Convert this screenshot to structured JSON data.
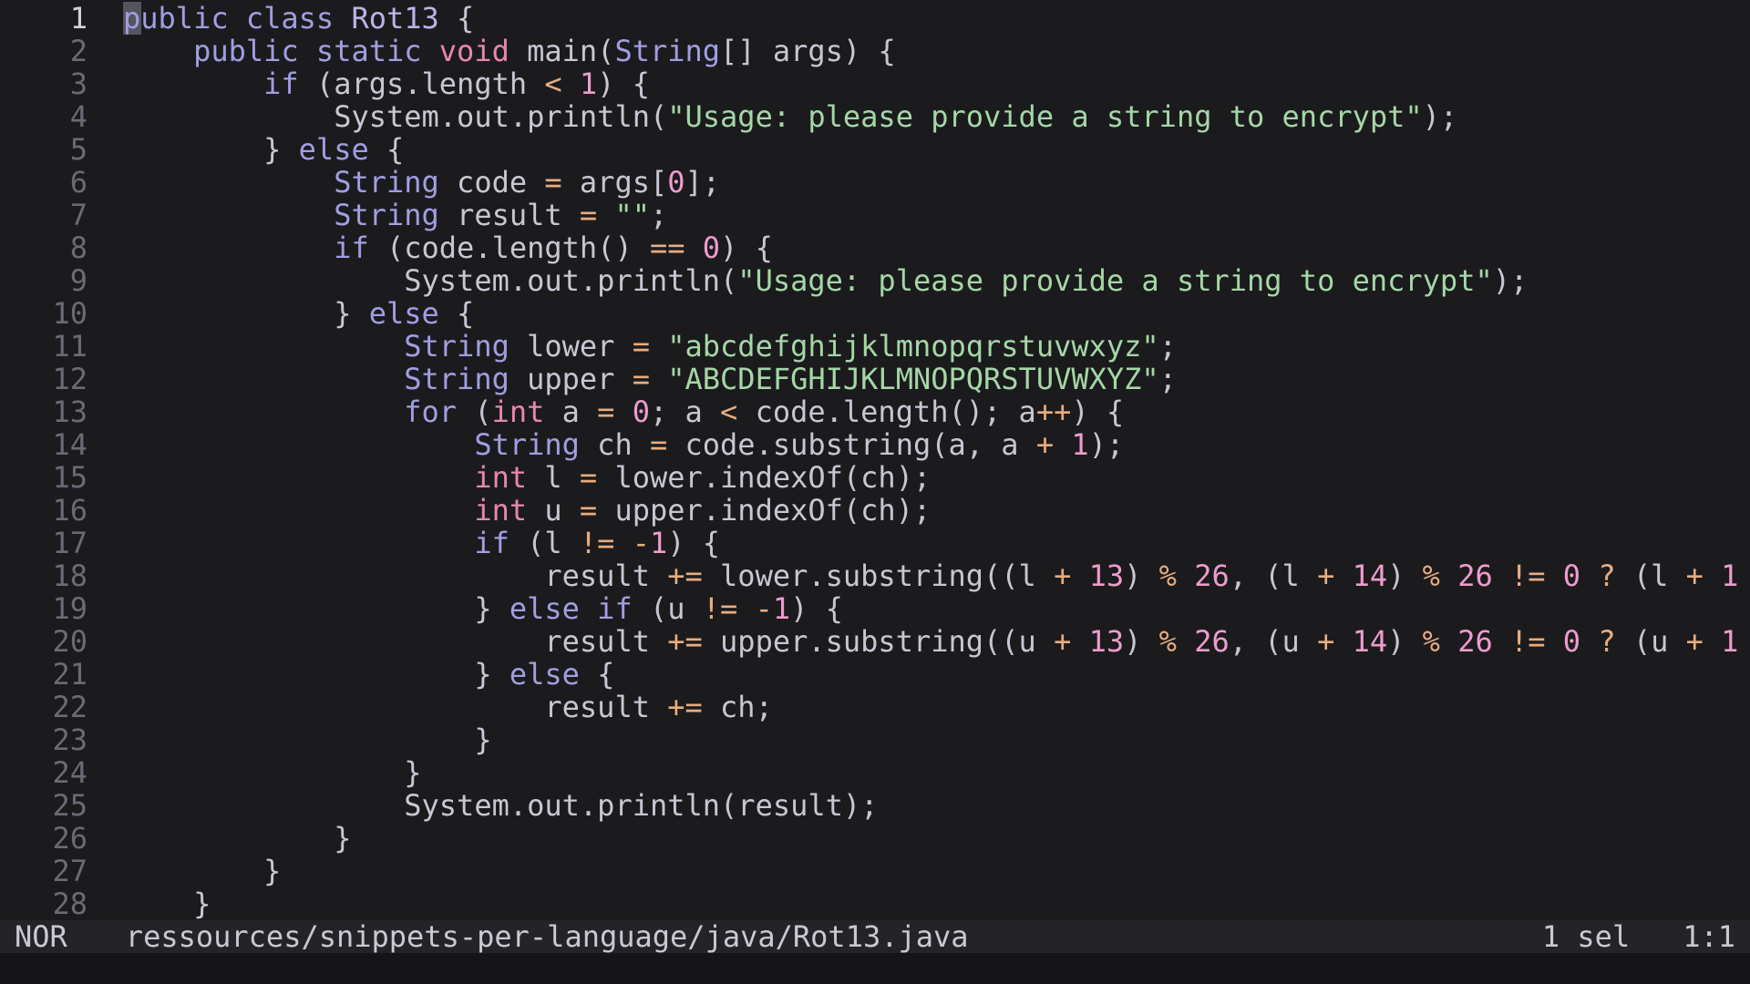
{
  "palette": {
    "bg": "#1b1b1d",
    "cmdBg": "#151517",
    "statusBg": "#242428",
    "statusFg": "#cac8d2",
    "gutter": "#6c6a75",
    "gutterCur": "#d4d1dc",
    "cursor": "#55555e",
    "tx": "#c8c6d2",
    "kw": "#a19ee3",
    "ty": "#bcb3e8",
    "pr": "#e787ad",
    "nu": "#ee9ccd",
    "op": "#e8ad80",
    "st": "#a5d7a7"
  },
  "editor": {
    "cursor": {
      "line": 1,
      "col": 0
    },
    "lines": [
      {
        "num": "1",
        "current": true,
        "tokens": [
          [
            "kw",
            "public"
          ],
          [
            "tx",
            " "
          ],
          [
            "kw",
            "class"
          ],
          [
            "tx",
            " "
          ],
          [
            "ty",
            "Rot13"
          ],
          [
            "tx",
            " {"
          ]
        ]
      },
      {
        "num": "2",
        "current": false,
        "tokens": [
          [
            "tx",
            "    "
          ],
          [
            "kw",
            "public"
          ],
          [
            "tx",
            " "
          ],
          [
            "kw",
            "static"
          ],
          [
            "tx",
            " "
          ],
          [
            "pr",
            "void"
          ],
          [
            "tx",
            " main("
          ],
          [
            "kw",
            "String"
          ],
          [
            "tx",
            "[] args) {"
          ]
        ]
      },
      {
        "num": "3",
        "current": false,
        "tokens": [
          [
            "tx",
            "        "
          ],
          [
            "kw",
            "if"
          ],
          [
            "tx",
            " (args.length "
          ],
          [
            "op",
            "<"
          ],
          [
            "tx",
            " "
          ],
          [
            "nu",
            "1"
          ],
          [
            "tx",
            ") {"
          ]
        ]
      },
      {
        "num": "4",
        "current": false,
        "tokens": [
          [
            "tx",
            "            System.out.println("
          ],
          [
            "st",
            "\"Usage: please provide a string to encrypt\""
          ],
          [
            "tx",
            ");"
          ]
        ]
      },
      {
        "num": "5",
        "current": false,
        "tokens": [
          [
            "tx",
            "        } "
          ],
          [
            "kw",
            "else"
          ],
          [
            "tx",
            " {"
          ]
        ]
      },
      {
        "num": "6",
        "current": false,
        "tokens": [
          [
            "tx",
            "            "
          ],
          [
            "kw",
            "String"
          ],
          [
            "tx",
            " code "
          ],
          [
            "op",
            "="
          ],
          [
            "tx",
            " args["
          ],
          [
            "nu",
            "0"
          ],
          [
            "tx",
            "];"
          ]
        ]
      },
      {
        "num": "7",
        "current": false,
        "tokens": [
          [
            "tx",
            "            "
          ],
          [
            "kw",
            "String"
          ],
          [
            "tx",
            " result "
          ],
          [
            "op",
            "="
          ],
          [
            "tx",
            " "
          ],
          [
            "st",
            "\"\""
          ],
          [
            "tx",
            ";"
          ]
        ]
      },
      {
        "num": "8",
        "current": false,
        "tokens": [
          [
            "tx",
            "            "
          ],
          [
            "kw",
            "if"
          ],
          [
            "tx",
            " (code.length() "
          ],
          [
            "op",
            "=="
          ],
          [
            "tx",
            " "
          ],
          [
            "nu",
            "0"
          ],
          [
            "tx",
            ") {"
          ]
        ]
      },
      {
        "num": "9",
        "current": false,
        "tokens": [
          [
            "tx",
            "                System.out.println("
          ],
          [
            "st",
            "\"Usage: please provide a string to encrypt\""
          ],
          [
            "tx",
            ");"
          ]
        ]
      },
      {
        "num": "10",
        "current": false,
        "tokens": [
          [
            "tx",
            "            } "
          ],
          [
            "kw",
            "else"
          ],
          [
            "tx",
            " {"
          ]
        ]
      },
      {
        "num": "11",
        "current": false,
        "tokens": [
          [
            "tx",
            "                "
          ],
          [
            "kw",
            "String"
          ],
          [
            "tx",
            " lower "
          ],
          [
            "op",
            "="
          ],
          [
            "tx",
            " "
          ],
          [
            "st",
            "\"abcdefghijklmnopqrstuvwxyz\""
          ],
          [
            "tx",
            ";"
          ]
        ]
      },
      {
        "num": "12",
        "current": false,
        "tokens": [
          [
            "tx",
            "                "
          ],
          [
            "kw",
            "String"
          ],
          [
            "tx",
            " upper "
          ],
          [
            "op",
            "="
          ],
          [
            "tx",
            " "
          ],
          [
            "st",
            "\"ABCDEFGHIJKLMNOPQRSTUVWXYZ\""
          ],
          [
            "tx",
            ";"
          ]
        ]
      },
      {
        "num": "13",
        "current": false,
        "tokens": [
          [
            "tx",
            "                "
          ],
          [
            "kw",
            "for"
          ],
          [
            "tx",
            " ("
          ],
          [
            "pr",
            "int"
          ],
          [
            "tx",
            " a "
          ],
          [
            "op",
            "="
          ],
          [
            "tx",
            " "
          ],
          [
            "nu",
            "0"
          ],
          [
            "tx",
            "; a "
          ],
          [
            "op",
            "<"
          ],
          [
            "tx",
            " code.length(); a"
          ],
          [
            "op",
            "++"
          ],
          [
            "tx",
            ") {"
          ]
        ]
      },
      {
        "num": "14",
        "current": false,
        "tokens": [
          [
            "tx",
            "                    "
          ],
          [
            "kw",
            "String"
          ],
          [
            "tx",
            " ch "
          ],
          [
            "op",
            "="
          ],
          [
            "tx",
            " code.substring(a, a "
          ],
          [
            "op",
            "+"
          ],
          [
            "tx",
            " "
          ],
          [
            "nu",
            "1"
          ],
          [
            "tx",
            ");"
          ]
        ]
      },
      {
        "num": "15",
        "current": false,
        "tokens": [
          [
            "tx",
            "                    "
          ],
          [
            "pr",
            "int"
          ],
          [
            "tx",
            " l "
          ],
          [
            "op",
            "="
          ],
          [
            "tx",
            " lower.indexOf(ch);"
          ]
        ]
      },
      {
        "num": "16",
        "current": false,
        "tokens": [
          [
            "tx",
            "                    "
          ],
          [
            "pr",
            "int"
          ],
          [
            "tx",
            " u "
          ],
          [
            "op",
            "="
          ],
          [
            "tx",
            " upper.indexOf(ch);"
          ]
        ]
      },
      {
        "num": "17",
        "current": false,
        "tokens": [
          [
            "tx",
            "                    "
          ],
          [
            "kw",
            "if"
          ],
          [
            "tx",
            " (l "
          ],
          [
            "op",
            "!="
          ],
          [
            "tx",
            " "
          ],
          [
            "op",
            "-"
          ],
          [
            "nu",
            "1"
          ],
          [
            "tx",
            ") {"
          ]
        ]
      },
      {
        "num": "18",
        "current": false,
        "tokens": [
          [
            "tx",
            "                        result "
          ],
          [
            "op",
            "+="
          ],
          [
            "tx",
            " lower.substring((l "
          ],
          [
            "op",
            "+"
          ],
          [
            "tx",
            " "
          ],
          [
            "nu",
            "13"
          ],
          [
            "tx",
            ") "
          ],
          [
            "op",
            "%"
          ],
          [
            "tx",
            " "
          ],
          [
            "nu",
            "26"
          ],
          [
            "tx",
            ", (l "
          ],
          [
            "op",
            "+"
          ],
          [
            "tx",
            " "
          ],
          [
            "nu",
            "14"
          ],
          [
            "tx",
            ") "
          ],
          [
            "op",
            "%"
          ],
          [
            "tx",
            " "
          ],
          [
            "nu",
            "26"
          ],
          [
            "tx",
            " "
          ],
          [
            "op",
            "!="
          ],
          [
            "tx",
            " "
          ],
          [
            "nu",
            "0"
          ],
          [
            "tx",
            " "
          ],
          [
            "op",
            "?"
          ],
          [
            "tx",
            " (l "
          ],
          [
            "op",
            "+"
          ],
          [
            "tx",
            " "
          ],
          [
            "nu",
            "1"
          ]
        ]
      },
      {
        "num": "19",
        "current": false,
        "tokens": [
          [
            "tx",
            "                    } "
          ],
          [
            "kw",
            "else"
          ],
          [
            "tx",
            " "
          ],
          [
            "kw",
            "if"
          ],
          [
            "tx",
            " (u "
          ],
          [
            "op",
            "!="
          ],
          [
            "tx",
            " "
          ],
          [
            "op",
            "-"
          ],
          [
            "nu",
            "1"
          ],
          [
            "tx",
            ") {"
          ]
        ]
      },
      {
        "num": "20",
        "current": false,
        "tokens": [
          [
            "tx",
            "                        result "
          ],
          [
            "op",
            "+="
          ],
          [
            "tx",
            " upper.substring((u "
          ],
          [
            "op",
            "+"
          ],
          [
            "tx",
            " "
          ],
          [
            "nu",
            "13"
          ],
          [
            "tx",
            ") "
          ],
          [
            "op",
            "%"
          ],
          [
            "tx",
            " "
          ],
          [
            "nu",
            "26"
          ],
          [
            "tx",
            ", (u "
          ],
          [
            "op",
            "+"
          ],
          [
            "tx",
            " "
          ],
          [
            "nu",
            "14"
          ],
          [
            "tx",
            ") "
          ],
          [
            "op",
            "%"
          ],
          [
            "tx",
            " "
          ],
          [
            "nu",
            "26"
          ],
          [
            "tx",
            " "
          ],
          [
            "op",
            "!="
          ],
          [
            "tx",
            " "
          ],
          [
            "nu",
            "0"
          ],
          [
            "tx",
            " "
          ],
          [
            "op",
            "?"
          ],
          [
            "tx",
            " (u "
          ],
          [
            "op",
            "+"
          ],
          [
            "tx",
            " "
          ],
          [
            "nu",
            "1"
          ]
        ]
      },
      {
        "num": "21",
        "current": false,
        "tokens": [
          [
            "tx",
            "                    } "
          ],
          [
            "kw",
            "else"
          ],
          [
            "tx",
            " {"
          ]
        ]
      },
      {
        "num": "22",
        "current": false,
        "tokens": [
          [
            "tx",
            "                        result "
          ],
          [
            "op",
            "+="
          ],
          [
            "tx",
            " ch;"
          ]
        ]
      },
      {
        "num": "23",
        "current": false,
        "tokens": [
          [
            "tx",
            "                    }"
          ]
        ]
      },
      {
        "num": "24",
        "current": false,
        "tokens": [
          [
            "tx",
            "                }"
          ]
        ]
      },
      {
        "num": "25",
        "current": false,
        "tokens": [
          [
            "tx",
            "                System.out.println(result);"
          ]
        ]
      },
      {
        "num": "26",
        "current": false,
        "tokens": [
          [
            "tx",
            "            }"
          ]
        ]
      },
      {
        "num": "27",
        "current": false,
        "tokens": [
          [
            "tx",
            "        }"
          ]
        ]
      },
      {
        "num": "28",
        "current": false,
        "tokens": [
          [
            "tx",
            "    }"
          ]
        ]
      }
    ]
  },
  "statusline": {
    "mode": "NOR",
    "file": "ressources/snippets-per-language/java/Rot13.java",
    "selections": "1 sel",
    "position": "1:1"
  }
}
